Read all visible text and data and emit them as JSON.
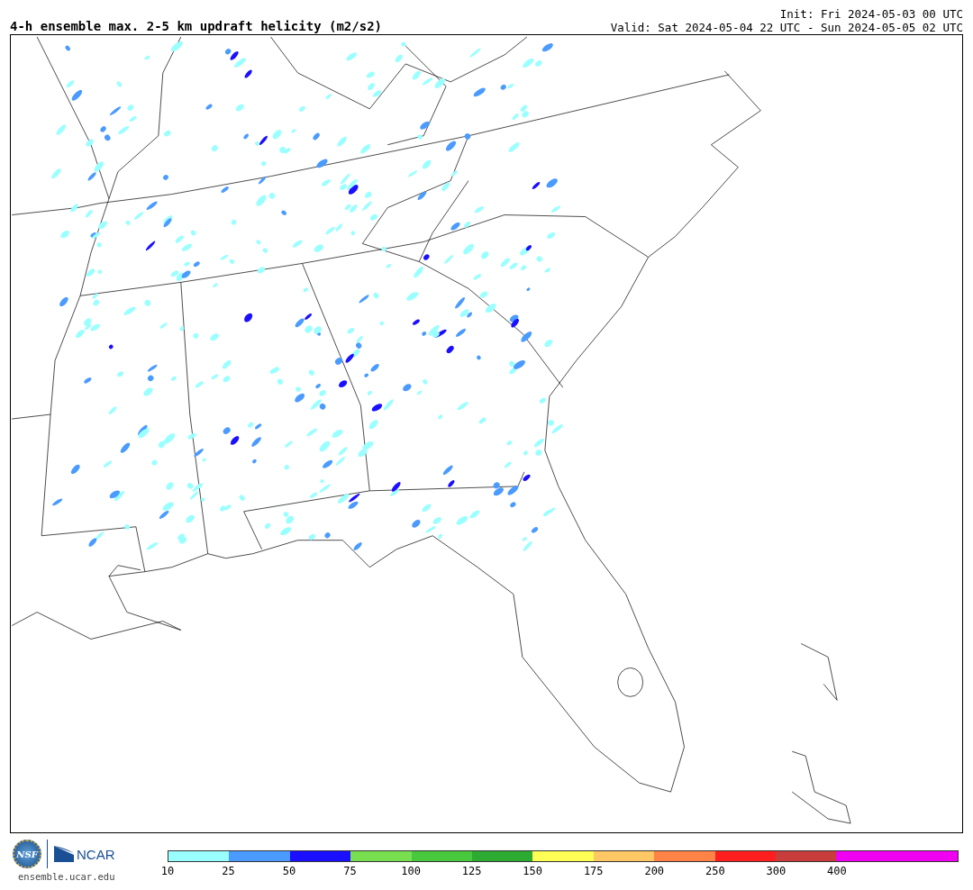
{
  "title": "4-h ensemble max. 2-5 km updraft helicity (m2/s2)",
  "init": "Init: Fri 2024-05-03 00 UTC",
  "valid": "Valid: Sat 2024-05-04 22 UTC - Sun 2024-05-05 02 UTC",
  "logos": {
    "nsf": "NSF",
    "ncar": "NCAR"
  },
  "site": "ensemble.ucar.edu",
  "colorbar": [
    {
      "color": "#99ffff",
      "label": "10"
    },
    {
      "color": "#4b9bff",
      "label": "25"
    },
    {
      "color": "#1a0fff",
      "label": "50"
    },
    {
      "color": "#78e050",
      "label": "75"
    },
    {
      "color": "#48c83c",
      "label": "100"
    },
    {
      "color": "#2daa32",
      "label": "125"
    },
    {
      "color": "#ffff55",
      "label": "150"
    },
    {
      "color": "#ffc864",
      "label": "175"
    },
    {
      "color": "#ff8246",
      "label": "200"
    },
    {
      "color": "#ff1e1e",
      "label": "250"
    },
    {
      "color": "#c83c3c",
      "label": "300"
    },
    {
      "color": "#f000f0",
      "label": "400"
    },
    {
      "color": "#f000f0"
    }
  ]
}
